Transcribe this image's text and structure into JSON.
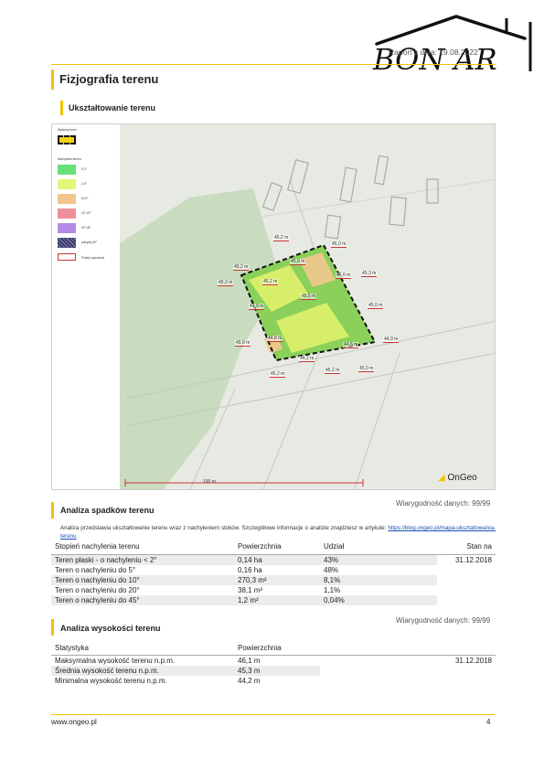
{
  "header": {
    "report_date": "Raport z dnia: 19.08.2022",
    "logo_text": "BON AR"
  },
  "page_title": "Fizjografia terenu",
  "section_terrain": {
    "title": "Ukształtowanie terenu"
  },
  "map": {
    "legend_title_boundary": "Wybrany teren",
    "legend_title_slopes": "Nachylenie terenu",
    "legend_items": [
      {
        "label": "0-2°",
        "color": "#66e07a"
      },
      {
        "label": "2-5°",
        "color": "#e5f57a"
      },
      {
        "label": "5-10°",
        "color": "#f3c58c"
      },
      {
        "label": "10°-20°",
        "color": "#ef8f9c"
      },
      {
        "label": "20°-45°",
        "color": "#b48ae6"
      },
      {
        "label": "powyżej 45°",
        "color": "#3a3a6a"
      }
    ],
    "legend_title_heights": "Punkty wysokości",
    "elevation_labels": [
      "45,2 m",
      "45,0 m",
      "45,9 m",
      "45,2 m",
      "46,0 m",
      "45,3 m",
      "45,2 m",
      "45,2 m",
      "45,0 m",
      "44,9 m",
      "45,5 m",
      "45,9 m",
      "44,8 m",
      "44,2 m",
      "44,6 m",
      "45,2 m",
      "45,2 m",
      "45,0 m",
      "44,9 m"
    ],
    "scale_label": "100 m",
    "brand": "OnGeo"
  },
  "section_slopes": {
    "title": "Analiza spadków terenu",
    "reliability": "Wiarygodność danych: 99/99",
    "description": "Analiza przedstawia ukształtowanie terenu wraz z nachyleniem stoków. Szczegółowe informacje o analizie znajdziesz w artykule:",
    "link": "https://blog.ongeo.pl/mapa-uksztaltowania-terenu",
    "columns": [
      "Stopień nachylenia terenu",
      "Powierzchnia",
      "Udział",
      "Stan na"
    ],
    "rows": [
      {
        "label": "Teren płaski - o nachyleniu < 2°",
        "area": "0,14 ha",
        "share": "43%",
        "date": "31.12.2018"
      },
      {
        "label": "Teren o nachyleniu do 5°",
        "area": "0,16 ha",
        "share": "48%",
        "date": ""
      },
      {
        "label": "Teren o nachyleniu do 10°",
        "area": "270,3 m²",
        "share": "8,1%",
        "date": ""
      },
      {
        "label": "Teren o nachyleniu do 20°",
        "area": "38,1 m²",
        "share": "1,1%",
        "date": ""
      },
      {
        "label": "Teren o nachyleniu do 45°",
        "area": "1,2 m²",
        "share": "0,04%",
        "date": ""
      }
    ]
  },
  "section_heights": {
    "title": "Analiza wysokości terenu",
    "reliability": "Wiarygodność danych: 99/99",
    "columns": [
      "Statystyka",
      "Powierzchnia"
    ],
    "rows": [
      {
        "label": "Maksymalna wysokość terenu n.p.m.",
        "value": "46,1 m",
        "date": "31.12.2018"
      },
      {
        "label": "Średnia wysokość terenu n.p.m.",
        "value": "45,3 m",
        "date": ""
      },
      {
        "label": "Minimalna wysokość terenu n.p.m.",
        "value": "44,2 m",
        "date": ""
      }
    ]
  },
  "footer": {
    "url": "www.ongeo.pl",
    "page": "4"
  }
}
